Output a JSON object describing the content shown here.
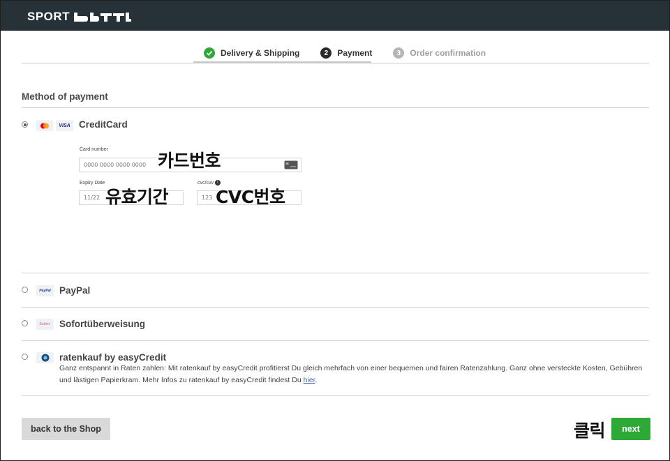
{
  "header": {
    "logo_text": "SPORT",
    "brand": "SPORT bittl"
  },
  "steps": [
    {
      "number": "✓",
      "label": "Delivery & Shipping",
      "state": "done"
    },
    {
      "number": "2",
      "label": "Payment",
      "state": "active"
    },
    {
      "number": "3",
      "label": "Order confirmation",
      "state": "todo"
    }
  ],
  "section_title": "Method of payment",
  "methods": {
    "creditcard": {
      "label": "CreditCard",
      "icons": [
        "mastercard-icon",
        "VISA"
      ],
      "card_number_label": "Card number",
      "card_number_placeholder": "0000 0000 0000 0000",
      "expiry_label": "Expiry Date",
      "expiry_placeholder": "11/22",
      "cvc_label": "cvc/cvv",
      "cvc_placeholder": "123",
      "overlay_card": "카드번호",
      "overlay_expiry": "유효기간",
      "overlay_cvc": "CVC번호"
    },
    "paypal": {
      "label": "PayPal",
      "icon_text": "PayPal"
    },
    "sofort": {
      "label": "Sofortüberweisung",
      "icon_text": "Sofort."
    },
    "easycredit": {
      "label": "ratenkauf by easyCredit",
      "description": "Ganz entspannt in Raten zahlen: Mit ratenkauf by easyCredit profitierst Du gleich mehrfach von einer bequemen und fairen Ratenzahlung. Ganz ohne versteckte Kosten, Gebühren und lästigen Papierkram. Mehr Infos zu ratenkauf by easyCredit findest Du ",
      "link_text": "hier"
    }
  },
  "footer": {
    "back_label": "back to the Shop",
    "next_label": "next",
    "click_overlay": "클릭"
  },
  "colors": {
    "topbar": "#263238",
    "accent_green": "#2ea836"
  }
}
